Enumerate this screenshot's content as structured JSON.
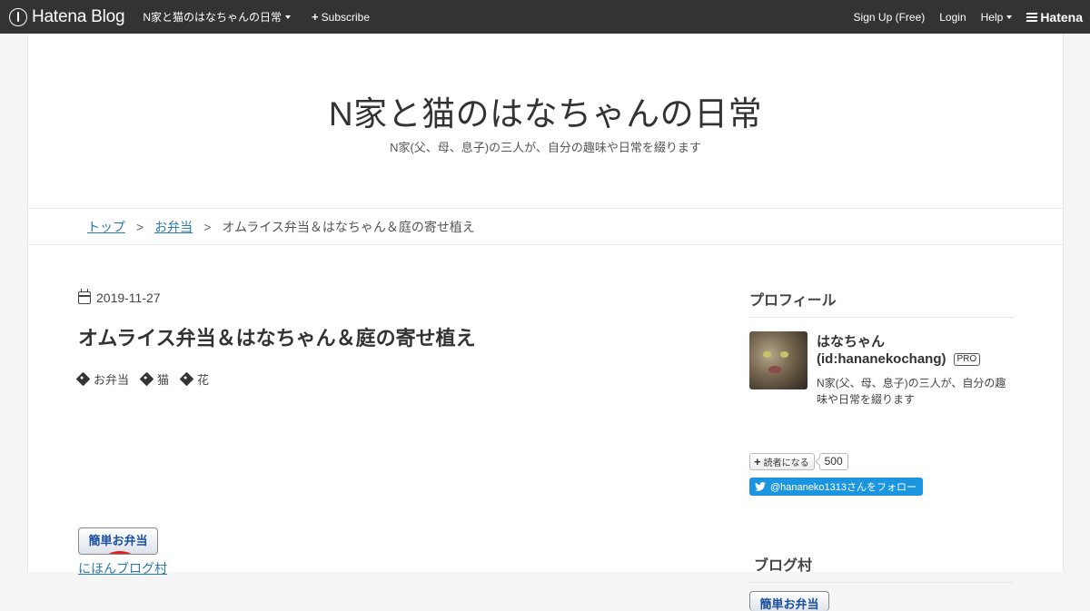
{
  "navbar": {
    "logo_text": "Hatena Blog",
    "blog_menu": "N家と猫のはなちゃんの日常",
    "subscribe": "Subscribe",
    "signup": "Sign Up (Free)",
    "login": "Login",
    "help": "Help",
    "hatena": "Hatena"
  },
  "header": {
    "title": "N家と猫のはなちゃんの日常",
    "description": "N家(父、母、息子)の三人が、自分の趣味や日常を綴ります"
  },
  "breadcrumb": {
    "top": "トップ",
    "category": "お弁当",
    "current": "オムライス弁当＆はなちゃん＆庭の寄せ植え",
    "separator": ">"
  },
  "entry": {
    "date": "2019-11-27",
    "title": "オムライス弁当＆はなちゃん＆庭の寄せ植え",
    "tags": [
      "お弁当",
      "猫",
      "花"
    ],
    "banner_text": "簡単お弁当",
    "village_link": "にほんブログ村"
  },
  "sidebar": {
    "profile_heading": "プロフィール",
    "name": "はなちゃん",
    "id": "(id:hananekochang)",
    "pro_badge": "PRO",
    "description": "N家(父、母、息子)の三人が、自分の趣味や日常を綴ります",
    "subscribe_label": "読者になる",
    "subscribers": "500",
    "twitter_follow": "@hananeko1313さんをフォロー",
    "village_heading": "ブログ村",
    "village_banner_text": "簡単お弁当"
  },
  "colors": {
    "navbar_bg": "#333333",
    "link": "#2a7ab0",
    "twitter": "#1b95e0"
  }
}
